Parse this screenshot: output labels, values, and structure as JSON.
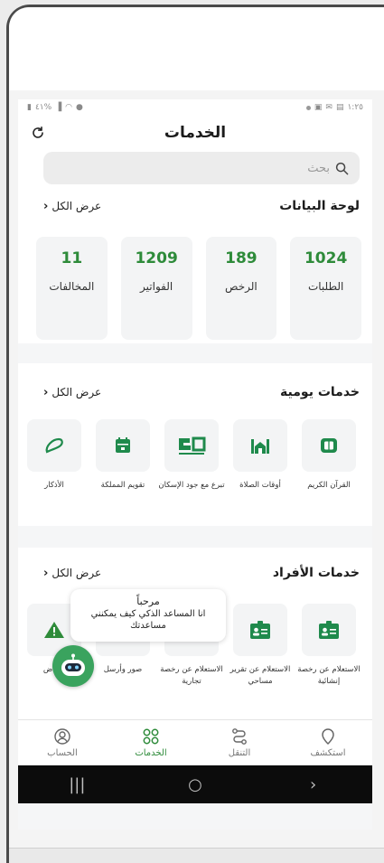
{
  "status_bar": {
    "left": "٤١%",
    "right": "١:٢٥"
  },
  "header": {
    "title": "الخدمات"
  },
  "search": {
    "placeholder": "بحث"
  },
  "dashboard": {
    "title": "لوحة البيانات",
    "view_all": "عرض الكل",
    "stats": [
      {
        "value": "1024",
        "label": "الطلبات"
      },
      {
        "value": "189",
        "label": "الرخص"
      },
      {
        "value": "1209",
        "label": "الفواتير"
      },
      {
        "value": "11",
        "label": "المخالفات"
      }
    ]
  },
  "daily_services": {
    "title": "خدمات يومية",
    "view_all": "عرض الكل",
    "items": [
      {
        "label": "القرآن الكريم",
        "icon": "quran-icon"
      },
      {
        "label": "أوقات الصلاة",
        "icon": "mosque-icon"
      },
      {
        "label": "تبرع مع جود الإسكان",
        "icon": "jood-logo-icon"
      },
      {
        "label": "تقويم المملكة",
        "icon": "calendar-icon"
      },
      {
        "label": "الأذكار",
        "icon": "prayer-beads-icon"
      }
    ]
  },
  "individual_services": {
    "title": "خدمات الأفراد",
    "view_all": "عرض الكل",
    "items": [
      {
        "label": "الاستعلام عن رخصة إنشائية",
        "icon": "id-card-icon"
      },
      {
        "label": "الاستعلام عن تقرير مساحي",
        "icon": "id-card-icon"
      },
      {
        "label": "الاستعلام عن رخصة تجارية",
        "icon": "id-card-icon"
      },
      {
        "label": "صور وأرسل",
        "icon": "camera-icon"
      },
      {
        "label": "لا راض",
        "icon": "warning-icon"
      }
    ]
  },
  "assistant": {
    "greeting": "مرحباً",
    "message": "انا المساعد الذكي كيف يمكنني مساعدتك"
  },
  "bottom_nav": [
    {
      "label": "استكشف",
      "icon": "location-pin-icon"
    },
    {
      "label": "التنقل",
      "icon": "route-icon"
    },
    {
      "label": "الخدمات",
      "icon": "grid-icon"
    },
    {
      "label": "الحساب",
      "icon": "user-icon"
    }
  ],
  "colors": {
    "accent": "#2e8b3a",
    "tile_icon": "#1f8a4c",
    "warning": "#2e8b3a"
  }
}
